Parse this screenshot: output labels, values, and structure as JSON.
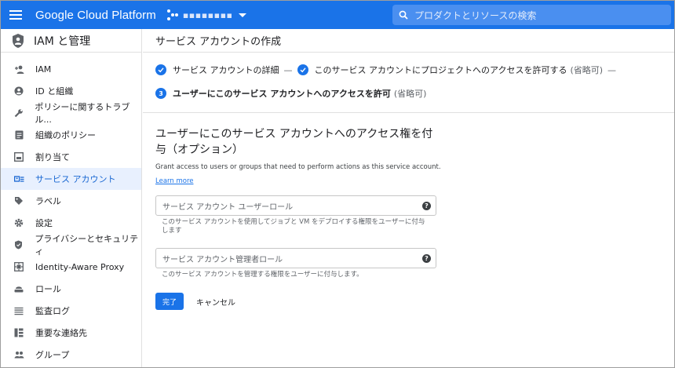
{
  "topbar": {
    "brand": "Google Cloud Platform",
    "project_name": "▪▪▪▪▪▪▪▪",
    "search_placeholder": "プロダクトとリソースの検索"
  },
  "sidebar": {
    "title": "IAM と管理",
    "items": [
      {
        "label": "IAM",
        "icon": "person-add-icon"
      },
      {
        "label": "ID と組織",
        "icon": "account-circle-icon"
      },
      {
        "label": "ポリシーに関するトラブル...",
        "icon": "wrench-icon"
      },
      {
        "label": "組織のポリシー",
        "icon": "document-icon"
      },
      {
        "label": "割り当て",
        "icon": "quota-icon"
      },
      {
        "label": "サービス アカウント",
        "icon": "service-account-icon",
        "active": true
      },
      {
        "label": "ラベル",
        "icon": "label-icon"
      },
      {
        "label": "設定",
        "icon": "gear-icon"
      },
      {
        "label": "プライバシーとセキュリティ",
        "icon": "shield-icon"
      },
      {
        "label": "Identity-Aware Proxy",
        "icon": "proxy-icon"
      },
      {
        "label": "ロール",
        "icon": "roles-icon"
      },
      {
        "label": "監査ログ",
        "icon": "list-icon"
      },
      {
        "label": "重要な連絡先",
        "icon": "contacts-icon"
      },
      {
        "label": "グループ",
        "icon": "group-icon"
      }
    ]
  },
  "main": {
    "page_title": "サービス アカウントの作成",
    "steps": {
      "step1": "サービス アカウントの詳細",
      "dash": "—",
      "step2": "このサービス アカウントにプロジェクトへのアクセスを許可する",
      "step2_opt": "(省略可)",
      "step2_dash": "—",
      "step3_num": "3",
      "step3": "ユーザーにこのサービス アカウントへのアクセスを許可",
      "step3_opt": "(省略可)"
    },
    "section": {
      "title": "ユーザーにこのサービス アカウントへのアクセス権を付与（オプション）",
      "desc": "Grant access to users or groups that need to perform actions as this service account.",
      "learn_more": "Learn more",
      "field1_placeholder": "サービス アカウント ユーザーロール",
      "field1_hint": "このサービス アカウントを使用してジョブと VM をデプロイする権限をユーザーに付与します",
      "field2_placeholder": "サービス アカウント管理者ロール",
      "field2_hint": "このサービス アカウントを管理する権限をユーザーに付与します。",
      "help_glyph": "?",
      "done_label": "完了",
      "cancel_label": "キャンセル"
    }
  },
  "colors": {
    "primary": "#1a73e8",
    "active_bg": "#e8f0fe",
    "active_text": "#1967d2"
  }
}
